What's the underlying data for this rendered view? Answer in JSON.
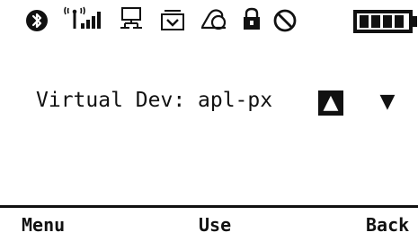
{
  "status_bar": {
    "icons": [
      "bluetooth-icon",
      "signal-strength-icon",
      "network-icon",
      "voicemail-icon",
      "call-forward-icon",
      "lock-icon",
      "do-not-disturb-icon",
      "battery-icon"
    ]
  },
  "main": {
    "label": "Virtual Dev: apl-px",
    "up_arrow": "▲",
    "down_arrow": "▼"
  },
  "softkeys": {
    "left": "Menu",
    "center": "Use",
    "right": "Back"
  },
  "colors": {
    "foreground": "#111111",
    "background": "#ffffff"
  }
}
